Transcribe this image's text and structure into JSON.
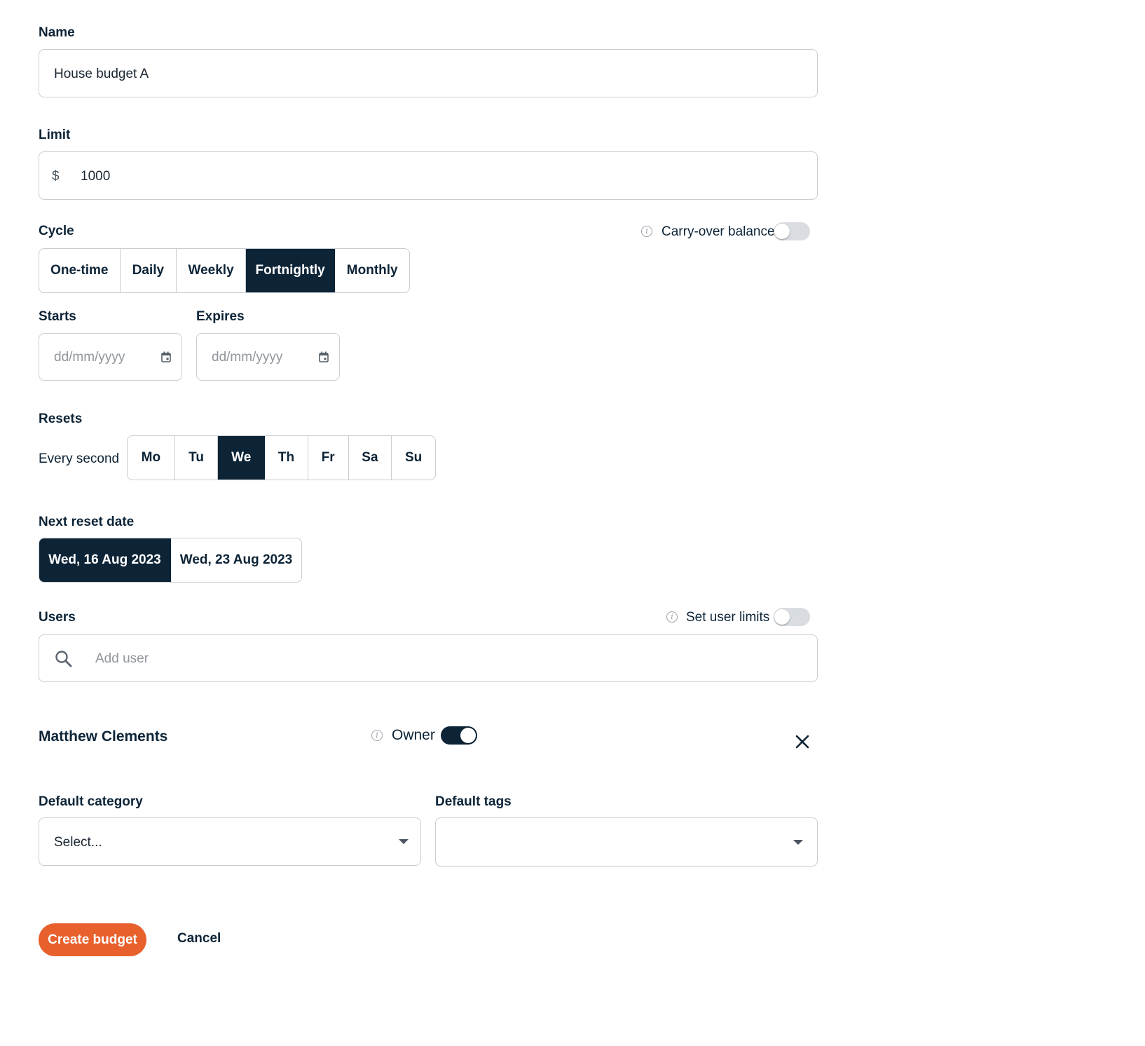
{
  "form": {
    "name": {
      "label": "Name",
      "value": "House budget A"
    },
    "limit": {
      "label": "Limit",
      "currency_symbol": "$",
      "value": "1000"
    },
    "cycle": {
      "label": "Cycle",
      "options": [
        "One-time",
        "Daily",
        "Weekly",
        "Fortnightly",
        "Monthly"
      ],
      "selected": "Fortnightly",
      "carry_over": {
        "label": "Carry-over balance",
        "enabled": false
      }
    },
    "starts": {
      "label": "Starts",
      "placeholder": "dd/mm/yyyy"
    },
    "expires": {
      "label": "Expires",
      "placeholder": "dd/mm/yyyy"
    },
    "resets": {
      "label": "Resets",
      "prefix": "Every second",
      "days": [
        "Mo",
        "Tu",
        "We",
        "Th",
        "Fr",
        "Sa",
        "Su"
      ],
      "selected": "We"
    },
    "next_reset": {
      "label": "Next reset date",
      "options": [
        "Wed, 16 Aug 2023",
        "Wed, 23 Aug 2023"
      ],
      "selected": "Wed, 16 Aug 2023"
    },
    "users": {
      "label": "Users",
      "set_user_limits": {
        "label": "Set user limits",
        "enabled": false
      },
      "search_placeholder": "Add user",
      "entries": [
        {
          "name": "Matthew Clements",
          "owner_label": "Owner",
          "owner": true
        }
      ]
    },
    "default_category": {
      "label": "Default category",
      "value": "Select..."
    },
    "default_tags": {
      "label": "Default tags",
      "value": ""
    },
    "actions": {
      "create_label": "Create budget",
      "cancel_label": "Cancel"
    }
  },
  "colors": {
    "primary": "#0d2437",
    "accent": "#e8602c",
    "border": "#c9cdd2"
  },
  "icons": [
    "info-icon",
    "calendar-icon",
    "search-icon",
    "close-icon",
    "chevron-down-icon"
  ]
}
